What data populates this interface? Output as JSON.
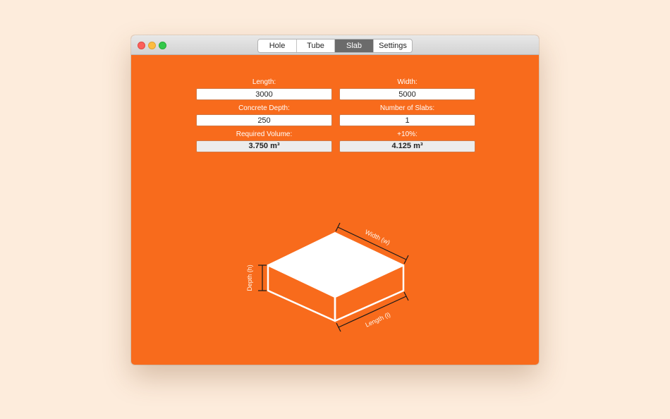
{
  "window": {
    "tabs": [
      {
        "label": "Hole",
        "active": false
      },
      {
        "label": "Tube",
        "active": false
      },
      {
        "label": "Slab",
        "active": true
      },
      {
        "label": "Settings",
        "active": false
      }
    ]
  },
  "form": {
    "length": {
      "label": "Length:",
      "value": "3000"
    },
    "width": {
      "label": "Width:",
      "value": "5000"
    },
    "concrete_depth": {
      "label": "Concrete Depth:",
      "value": "250"
    },
    "number_of_slabs": {
      "label": "Number of Slabs:",
      "value": "1"
    },
    "required_volume": {
      "label": "Required Volume:",
      "value": "3.750 m³"
    },
    "plus_ten": {
      "label": "+10%:",
      "value": "4.125 m³"
    }
  },
  "diagram": {
    "width_label": "Width (w)",
    "length_label": "Length (l)",
    "depth_label": "Depth (h)"
  },
  "colors": {
    "background": "#fdecdc",
    "accent": "#f86b1c",
    "active_tab": "#6b6b6b"
  }
}
